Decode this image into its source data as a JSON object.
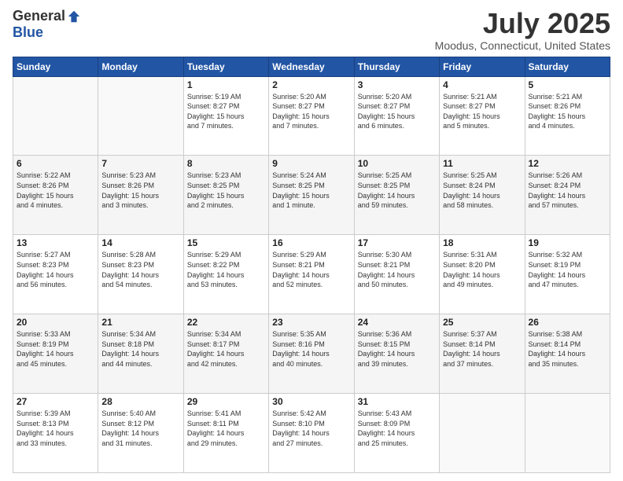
{
  "logo": {
    "general": "General",
    "blue": "Blue"
  },
  "title": "July 2025",
  "subtitle": "Moodus, Connecticut, United States",
  "weekdays": [
    "Sunday",
    "Monday",
    "Tuesday",
    "Wednesday",
    "Thursday",
    "Friday",
    "Saturday"
  ],
  "weeks": [
    [
      {
        "day": "",
        "info": ""
      },
      {
        "day": "",
        "info": ""
      },
      {
        "day": "1",
        "info": "Sunrise: 5:19 AM\nSunset: 8:27 PM\nDaylight: 15 hours\nand 7 minutes."
      },
      {
        "day": "2",
        "info": "Sunrise: 5:20 AM\nSunset: 8:27 PM\nDaylight: 15 hours\nand 7 minutes."
      },
      {
        "day": "3",
        "info": "Sunrise: 5:20 AM\nSunset: 8:27 PM\nDaylight: 15 hours\nand 6 minutes."
      },
      {
        "day": "4",
        "info": "Sunrise: 5:21 AM\nSunset: 8:27 PM\nDaylight: 15 hours\nand 5 minutes."
      },
      {
        "day": "5",
        "info": "Sunrise: 5:21 AM\nSunset: 8:26 PM\nDaylight: 15 hours\nand 4 minutes."
      }
    ],
    [
      {
        "day": "6",
        "info": "Sunrise: 5:22 AM\nSunset: 8:26 PM\nDaylight: 15 hours\nand 4 minutes."
      },
      {
        "day": "7",
        "info": "Sunrise: 5:23 AM\nSunset: 8:26 PM\nDaylight: 15 hours\nand 3 minutes."
      },
      {
        "day": "8",
        "info": "Sunrise: 5:23 AM\nSunset: 8:25 PM\nDaylight: 15 hours\nand 2 minutes."
      },
      {
        "day": "9",
        "info": "Sunrise: 5:24 AM\nSunset: 8:25 PM\nDaylight: 15 hours\nand 1 minute."
      },
      {
        "day": "10",
        "info": "Sunrise: 5:25 AM\nSunset: 8:25 PM\nDaylight: 14 hours\nand 59 minutes."
      },
      {
        "day": "11",
        "info": "Sunrise: 5:25 AM\nSunset: 8:24 PM\nDaylight: 14 hours\nand 58 minutes."
      },
      {
        "day": "12",
        "info": "Sunrise: 5:26 AM\nSunset: 8:24 PM\nDaylight: 14 hours\nand 57 minutes."
      }
    ],
    [
      {
        "day": "13",
        "info": "Sunrise: 5:27 AM\nSunset: 8:23 PM\nDaylight: 14 hours\nand 56 minutes."
      },
      {
        "day": "14",
        "info": "Sunrise: 5:28 AM\nSunset: 8:23 PM\nDaylight: 14 hours\nand 54 minutes."
      },
      {
        "day": "15",
        "info": "Sunrise: 5:29 AM\nSunset: 8:22 PM\nDaylight: 14 hours\nand 53 minutes."
      },
      {
        "day": "16",
        "info": "Sunrise: 5:29 AM\nSunset: 8:21 PM\nDaylight: 14 hours\nand 52 minutes."
      },
      {
        "day": "17",
        "info": "Sunrise: 5:30 AM\nSunset: 8:21 PM\nDaylight: 14 hours\nand 50 minutes."
      },
      {
        "day": "18",
        "info": "Sunrise: 5:31 AM\nSunset: 8:20 PM\nDaylight: 14 hours\nand 49 minutes."
      },
      {
        "day": "19",
        "info": "Sunrise: 5:32 AM\nSunset: 8:19 PM\nDaylight: 14 hours\nand 47 minutes."
      }
    ],
    [
      {
        "day": "20",
        "info": "Sunrise: 5:33 AM\nSunset: 8:19 PM\nDaylight: 14 hours\nand 45 minutes."
      },
      {
        "day": "21",
        "info": "Sunrise: 5:34 AM\nSunset: 8:18 PM\nDaylight: 14 hours\nand 44 minutes."
      },
      {
        "day": "22",
        "info": "Sunrise: 5:34 AM\nSunset: 8:17 PM\nDaylight: 14 hours\nand 42 minutes."
      },
      {
        "day": "23",
        "info": "Sunrise: 5:35 AM\nSunset: 8:16 PM\nDaylight: 14 hours\nand 40 minutes."
      },
      {
        "day": "24",
        "info": "Sunrise: 5:36 AM\nSunset: 8:15 PM\nDaylight: 14 hours\nand 39 minutes."
      },
      {
        "day": "25",
        "info": "Sunrise: 5:37 AM\nSunset: 8:14 PM\nDaylight: 14 hours\nand 37 minutes."
      },
      {
        "day": "26",
        "info": "Sunrise: 5:38 AM\nSunset: 8:14 PM\nDaylight: 14 hours\nand 35 minutes."
      }
    ],
    [
      {
        "day": "27",
        "info": "Sunrise: 5:39 AM\nSunset: 8:13 PM\nDaylight: 14 hours\nand 33 minutes."
      },
      {
        "day": "28",
        "info": "Sunrise: 5:40 AM\nSunset: 8:12 PM\nDaylight: 14 hours\nand 31 minutes."
      },
      {
        "day": "29",
        "info": "Sunrise: 5:41 AM\nSunset: 8:11 PM\nDaylight: 14 hours\nand 29 minutes."
      },
      {
        "day": "30",
        "info": "Sunrise: 5:42 AM\nSunset: 8:10 PM\nDaylight: 14 hours\nand 27 minutes."
      },
      {
        "day": "31",
        "info": "Sunrise: 5:43 AM\nSunset: 8:09 PM\nDaylight: 14 hours\nand 25 minutes."
      },
      {
        "day": "",
        "info": ""
      },
      {
        "day": "",
        "info": ""
      }
    ]
  ]
}
